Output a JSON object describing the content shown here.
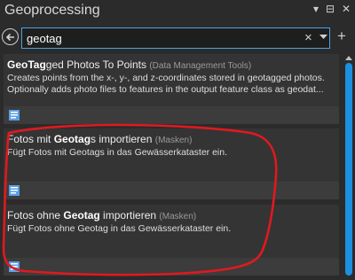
{
  "window": {
    "title": "Geoprocessing",
    "controls": [
      "▾",
      "⊟",
      "✕"
    ]
  },
  "search": {
    "value": "geotag",
    "clear_label": "×",
    "add_label": "+"
  },
  "results": [
    {
      "title_bold": "GeoTag",
      "title_rest": "ged Photos To Points",
      "toolbox": "(Data Management Tools)",
      "description_line1": "Creates points from the x-, y-, and z-coordinates stored in geotagged photos.",
      "description_line2": "Optionally adds photo files to features in the output feature class as geodat..."
    },
    {
      "title_pre": "Fotos mit ",
      "title_bold": "Geotag",
      "title_rest": "s importieren",
      "toolbox": "(Masken)",
      "description_line1": "Fügt Fotos mit Geotags in das Gewässerkataster ein."
    },
    {
      "title_pre": "Fotos ohne ",
      "title_bold": "Geotag",
      "title_rest": " importieren",
      "toolbox": "(Masken)",
      "description_line1": "Fügt Fotos ohne Geotag in das Gewässerkataster ein."
    }
  ],
  "colors": {
    "accent": "#1b8fe0",
    "annotation": "#e0191f"
  }
}
